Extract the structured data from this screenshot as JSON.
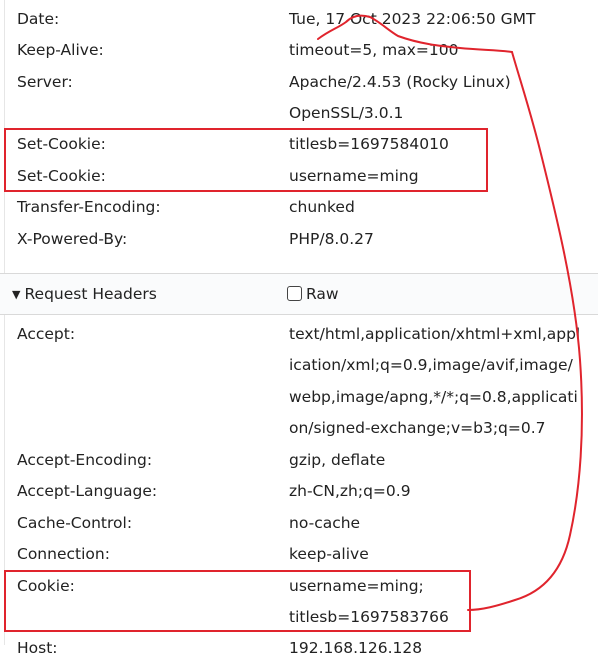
{
  "response_headers": [
    {
      "name": "Date:",
      "value": "Tue, 17 Oct 2023 22:06:50 GMT"
    },
    {
      "name": "Keep-Alive:",
      "value": "timeout=5, max=100"
    },
    {
      "name": "Server:",
      "value": "Apache/2.4.53 (Rocky Linux)"
    },
    {
      "name": "",
      "value": "OpenSSL/3.0.1"
    },
    {
      "name": "Set-Cookie:",
      "value": "titlesb=1697584010"
    },
    {
      "name": "Set-Cookie:",
      "value": "username=ming"
    },
    {
      "name": "Transfer-Encoding:",
      "value": "chunked"
    },
    {
      "name": "X-Powered-By:",
      "value": "PHP/8.0.27"
    }
  ],
  "request_section": {
    "title": "Request Headers",
    "raw_label": "Raw"
  },
  "request_headers": [
    {
      "name": "Accept:",
      "value": "text/html,application/xhtml+xml,appl"
    },
    {
      "name": "",
      "value": "ication/xml;q=0.9,image/avif,image/"
    },
    {
      "name": "",
      "value": "webp,image/apng,*/*;q=0.8,applicati"
    },
    {
      "name": "",
      "value": "on/signed-exchange;v=b3;q=0.7"
    },
    {
      "name": "Accept-Encoding:",
      "value": "gzip, deflate"
    },
    {
      "name": "Accept-Language:",
      "value": "zh-CN,zh;q=0.9"
    },
    {
      "name": "Cache-Control:",
      "value": "no-cache"
    },
    {
      "name": "Connection:",
      "value": "keep-alive"
    },
    {
      "name": "Cookie:",
      "value": "username=ming;"
    },
    {
      "name": "",
      "value": "titlesb=1697583766"
    },
    {
      "name": "Host:",
      "value": "192.168.126.128"
    }
  ],
  "annotation_color": "#e0242d"
}
